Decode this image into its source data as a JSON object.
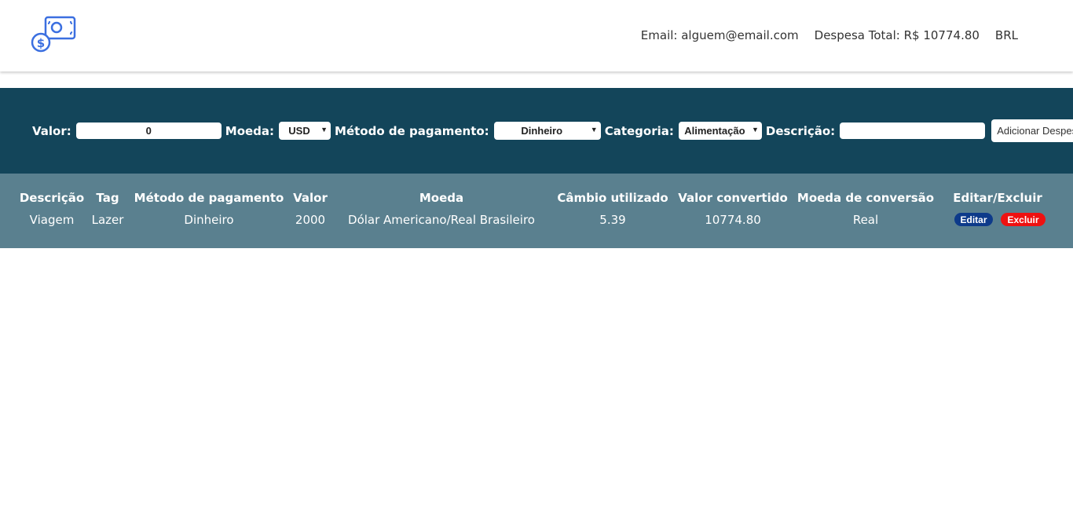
{
  "header": {
    "logo_icon": "money-bill-dollar-icon",
    "email": "Email: alguem@email.com",
    "total": "Despesa Total: R$ 10774.80",
    "currency": "BRL"
  },
  "form": {
    "value_label": "Valor:",
    "value": "0",
    "currency_label": "Moeda:",
    "currency_selected": "USD",
    "method_label": "Método de pagamento:",
    "method_selected": "Dinheiro",
    "category_label": "Categoria:",
    "category_selected": "Alimentação",
    "description_label": "Descrição:",
    "description_value": "",
    "add_button": "Adicionar Despesa"
  },
  "table": {
    "headers": [
      "Descrição",
      "Tag",
      "Método de pagamento",
      "Valor",
      "Moeda",
      "Câmbio utilizado",
      "Valor convertido",
      "Moeda de conversão",
      "Editar/Excluir"
    ],
    "rows": [
      {
        "description": "Viagem",
        "tag": "Lazer",
        "method": "Dinheiro",
        "value": "2000",
        "currency": "Dólar Americano/Real Brasileiro",
        "rate": "5.39",
        "converted": "10774.80",
        "conversion_currency": "Real",
        "edit_label": "Editar",
        "delete_label": "Excluir"
      }
    ]
  },
  "colors": {
    "form_bg": "#13455a",
    "table_bg": "#5a808f",
    "edit_btn": "#0d3a8a",
    "delete_btn": "#ee1111",
    "logo_blue": "#3b6fe0"
  }
}
